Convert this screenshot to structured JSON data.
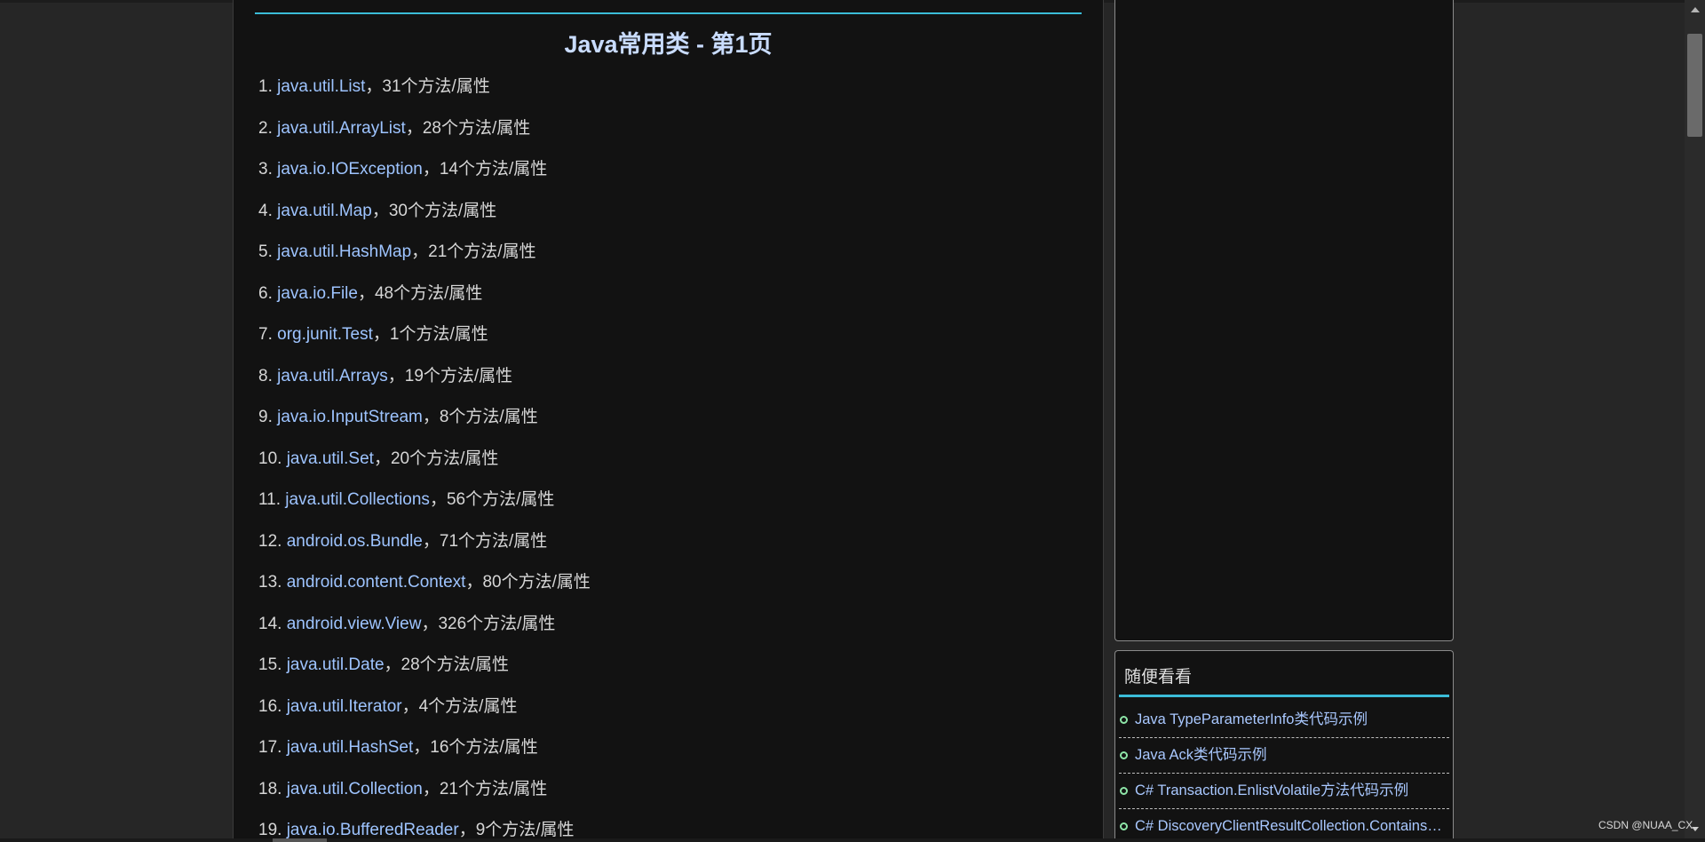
{
  "main": {
    "title": "Java常用类 - 第1页",
    "items": [
      {
        "num": "1.",
        "link": "java.util.List",
        "count": "，31个方法/属性"
      },
      {
        "num": "2.",
        "link": "java.util.ArrayList",
        "count": "，28个方法/属性"
      },
      {
        "num": "3.",
        "link": "java.io.IOException",
        "count": "，14个方法/属性"
      },
      {
        "num": "4.",
        "link": "java.util.Map",
        "count": "，30个方法/属性"
      },
      {
        "num": "5.",
        "link": "java.util.HashMap",
        "count": "，21个方法/属性"
      },
      {
        "num": "6.",
        "link": "java.io.File",
        "count": "，48个方法/属性"
      },
      {
        "num": "7.",
        "link": "org.junit.Test",
        "count": "，1个方法/属性"
      },
      {
        "num": "8.",
        "link": "java.util.Arrays",
        "count": "，19个方法/属性"
      },
      {
        "num": "9.",
        "link": "java.io.InputStream",
        "count": "，8个方法/属性"
      },
      {
        "num": "10.",
        "link": "java.util.Set",
        "count": "，20个方法/属性"
      },
      {
        "num": "11.",
        "link": "java.util.Collections",
        "count": "，56个方法/属性"
      },
      {
        "num": "12.",
        "link": "android.os.Bundle",
        "count": "，71个方法/属性"
      },
      {
        "num": "13.",
        "link": "android.content.Context",
        "count": "，80个方法/属性"
      },
      {
        "num": "14.",
        "link": "android.view.View",
        "count": "，326个方法/属性"
      },
      {
        "num": "15.",
        "link": "java.util.Date",
        "count": "，28个方法/属性"
      },
      {
        "num": "16.",
        "link": "java.util.Iterator",
        "count": "，4个方法/属性"
      },
      {
        "num": "17.",
        "link": "java.util.HashSet",
        "count": "，16个方法/属性"
      },
      {
        "num": "18.",
        "link": "java.util.Collection",
        "count": "，21个方法/属性"
      },
      {
        "num": "19.",
        "link": "java.io.BufferedReader",
        "count": "，9个方法/属性"
      }
    ]
  },
  "sidebar": {
    "title": "随便看看",
    "links": [
      "Java TypeParameterInfo类代码示例",
      "Java Ack类代码示例",
      "C# Transaction.EnlistVolatile方法代码示例",
      "C# DiscoveryClientResultCollection.ContainsKey方法代码示例"
    ]
  },
  "watermark": "CSDN @NUAA_CX",
  "colors": {
    "background": "#262626",
    "panel": "#121212",
    "accent": "#3bbcd8",
    "link": "#9ec4ff",
    "text": "#d6d6d6",
    "bullet": "#8ee6a8"
  }
}
